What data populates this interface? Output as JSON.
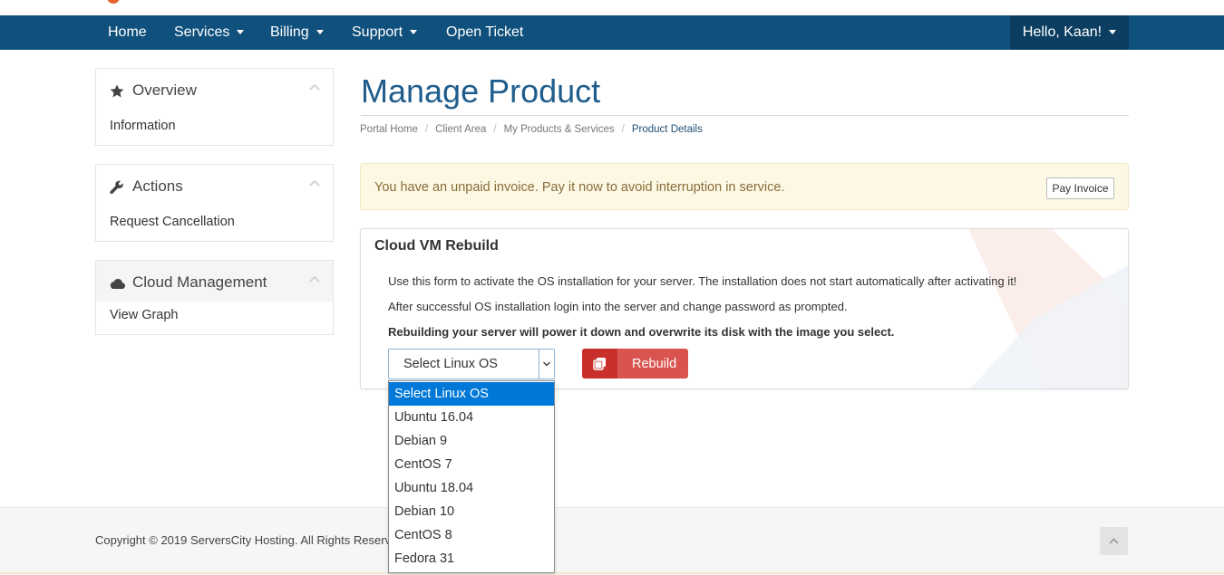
{
  "nav": {
    "items": [
      {
        "label": "Home",
        "caret": false
      },
      {
        "label": "Services",
        "caret": true
      },
      {
        "label": "Billing",
        "caret": true
      },
      {
        "label": "Support",
        "caret": true
      },
      {
        "label": "Open Ticket",
        "caret": false
      }
    ],
    "user": "Hello, Kaan!",
    "color": "#10507c"
  },
  "sidebar": {
    "panels": [
      {
        "title": "Overview",
        "icon": "star-icon",
        "link": "Information"
      },
      {
        "title": "Actions",
        "icon": "wrench-icon",
        "link": "Request Cancellation"
      },
      {
        "title": "Cloud Management",
        "icon": "cloud-icon",
        "link": "View Graph"
      }
    ]
  },
  "main": {
    "title": "Manage Product",
    "breadcrumb": [
      "Portal Home",
      "Client Area",
      "My Products & Services",
      "Product Details"
    ],
    "alert": {
      "text": "You have an unpaid invoice. Pay it now to avoid interruption in service.",
      "button": "Pay Invoice"
    },
    "rebuild": {
      "title": "Cloud VM Rebuild",
      "line1": "Use this form to activate the OS installation for your server. The installation does not start automatically after activating it!",
      "line2": "After successful OS installation login into the server and change password as prompted.",
      "line3": "Rebuilding your server will power it down and overwrite its disk with the image you select.",
      "select_value": "Select Linux OS",
      "button": "Rebuild",
      "button_color": "#d9534f"
    }
  },
  "dropdown": {
    "options": [
      "Select Linux OS",
      "Ubuntu 16.04",
      "Debian 9",
      "CentOS 7",
      "Ubuntu 18.04",
      "Debian 10",
      "CentOS 8",
      "Fedora 31"
    ],
    "selected_index": 0,
    "highlight_color": "#0078d7"
  },
  "footer": {
    "copyright": "Copyright © 2019 ServersCity Hosting. All Rights Reserv"
  }
}
